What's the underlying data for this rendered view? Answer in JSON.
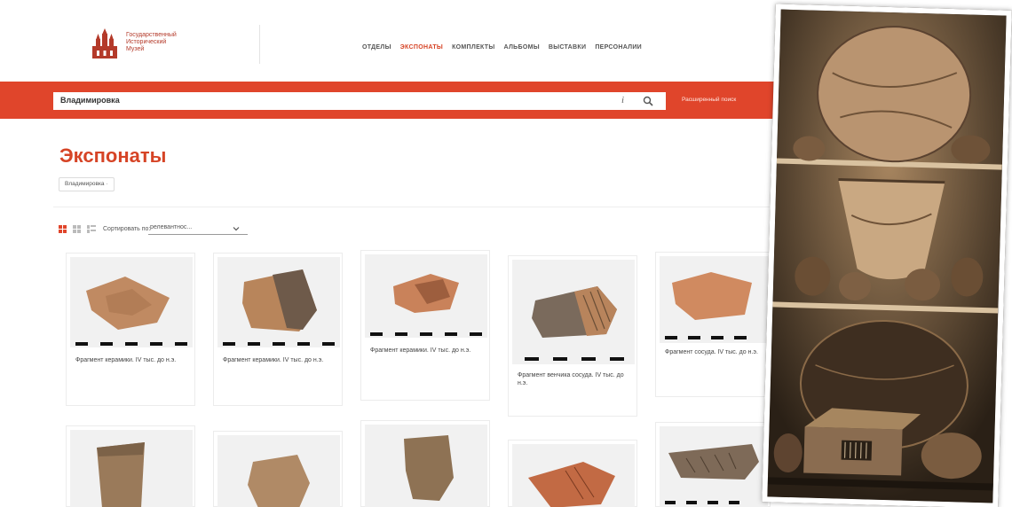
{
  "header": {
    "logo_lines": [
      "Государственный",
      "Исторический",
      "Музей"
    ],
    "nav": [
      {
        "label": "ОТДЕЛЫ",
        "active": false
      },
      {
        "label": "ЭКСПОНАТЫ",
        "active": true
      },
      {
        "label": "КОМПЛЕКТЫ",
        "active": false
      },
      {
        "label": "АЛЬБОМЫ",
        "active": false
      },
      {
        "label": "ВЫСТАВКИ",
        "active": false
      },
      {
        "label": "ПЕРСОНАЛИИ",
        "active": false
      }
    ]
  },
  "search": {
    "value": "Владимировка",
    "info_glyph": "i",
    "advanced_label": "Расширенный поиск"
  },
  "page": {
    "title": "Экспонаты",
    "filter_chip": "Владимировка ·"
  },
  "controls": {
    "sort_label": "Сортировать по:",
    "sort_value": "релевантнос..."
  },
  "cards": [
    {
      "title": "Фрагмент керамики. IV тыс. до н.э."
    },
    {
      "title": "Фрагмент керамики. IV тыс. до н.э."
    },
    {
      "title": "Фрагмент керамики. IV тыс. до н.э."
    },
    {
      "title": "Фрагмент венчика сосуда. IV тыс. до н.э."
    },
    {
      "title": "Фрагмент сосуда. IV тыс. до н.э."
    }
  ],
  "colors": {
    "accent": "#e0452b",
    "title": "#d64426",
    "photo_tone": "#8a6a44"
  },
  "icons": [
    "logo-icon",
    "info-icon",
    "search-icon",
    "grid-view-icon",
    "list-view-icon",
    "chevron-down-icon"
  ]
}
